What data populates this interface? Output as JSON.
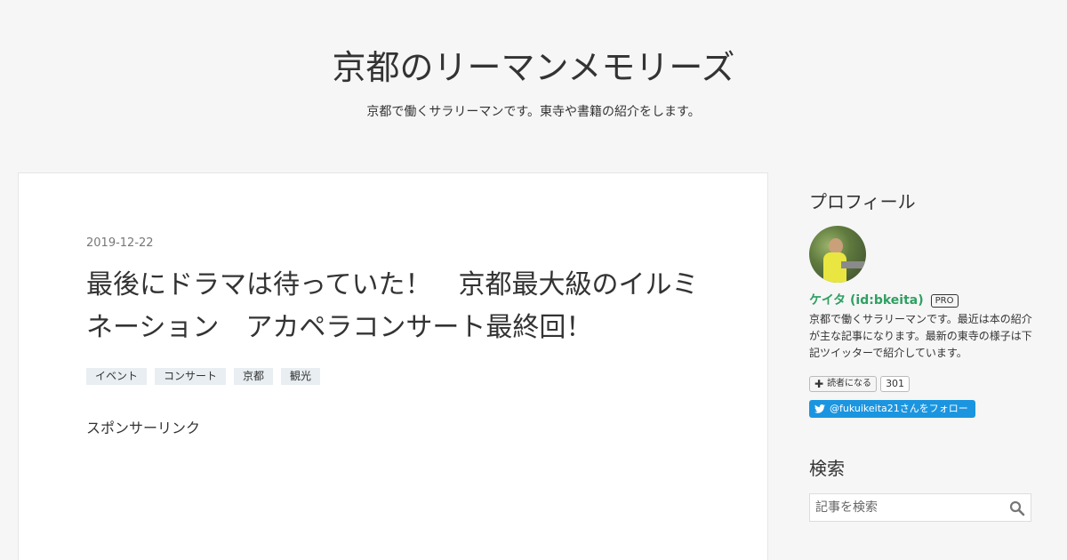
{
  "header": {
    "title": "京都のリーマンメモリーズ",
    "description": "京都で働くサラリーマンです。東寺や書籍の紹介をします。"
  },
  "entry": {
    "date": "2019-12-22",
    "title": "最後にドラマは待っていた！　京都最大級のイルミネーション　アカペラコンサート最終回！",
    "categories": [
      "イベント",
      "コンサート",
      "京都",
      "観光"
    ],
    "sponsor_label": "スポンサーリンク"
  },
  "sidebar": {
    "profile": {
      "heading": "プロフィール",
      "name": "ケイタ (id:bkeita)",
      "badge": "PRO",
      "description": "京都で働くサラリーマンです。最近は本の紹介が主な記事になります。最新の東寺の様子は下記ツイッターで紹介しています。",
      "reader_button_label": "読者になる",
      "reader_count": "301",
      "twitter_follow_label": "@fukuikeita21さんをフォロー"
    },
    "search": {
      "heading": "検索",
      "placeholder": "記事を検索"
    }
  },
  "colors": {
    "background": "#f6f6f6",
    "profile_name": "#2ea062",
    "twitter": "#1b95e0",
    "category_tag_bg": "#e8eef1"
  }
}
